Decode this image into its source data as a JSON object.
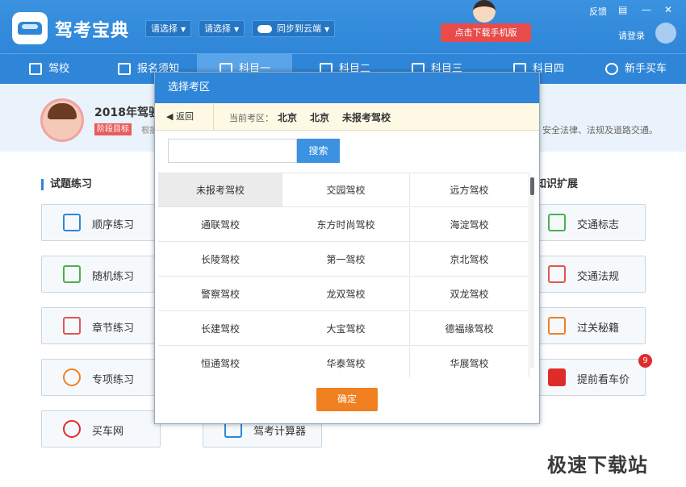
{
  "app": {
    "title": "驾考宝典",
    "select1": "请选择",
    "select2": "请选择",
    "sync": "同步到云端",
    "download": "点击下载手机版",
    "feedback": "反馈",
    "login": "请登录"
  },
  "nav": [
    {
      "label": "驾校"
    },
    {
      "label": "报名须知"
    },
    {
      "label": "科目一"
    },
    {
      "label": "科目二"
    },
    {
      "label": "科目三"
    },
    {
      "label": "科目四"
    },
    {
      "label": "新手买车"
    }
  ],
  "banner": {
    "title": "2018年驾驶员",
    "stage_badge": "阶段目标",
    "stage_text": "根据",
    "right_text": "安全法律、法规及道路交通。"
  },
  "sections": {
    "left": "试题练习",
    "right": "知识扩展"
  },
  "left_tiles": [
    "顺序练习",
    "随机练习",
    "章节练习",
    "专项练习",
    "买车网"
  ],
  "right_tiles": [
    "交通标志",
    "交通法规",
    "过关秘籍",
    "提前看车价"
  ],
  "bottom_tile": "驾考计算器",
  "price_badge": "9",
  "modal": {
    "title": "选择考区",
    "back": "返回",
    "crumb_label": "当前考区：",
    "crumb_city1": "北京",
    "crumb_city2": "北京",
    "crumb_school": "未报考驾校",
    "search_placeholder": "",
    "search_button": "搜索",
    "confirm": "确定",
    "schools": [
      [
        "未报考驾校",
        "交园驾校",
        "远方驾校"
      ],
      [
        "通联驾校",
        "东方时尚驾校",
        "海淀驾校"
      ],
      [
        "长陵驾校",
        "第一驾校",
        "京北驾校"
      ],
      [
        "警察驾校",
        "龙双驾校",
        "双龙驾校"
      ],
      [
        "长建驾校",
        "大宝驾校",
        "德福缘驾校"
      ],
      [
        "恒通驾校",
        "华泰驾校",
        "华展驾校"
      ]
    ]
  },
  "watermark": "极速下载站"
}
